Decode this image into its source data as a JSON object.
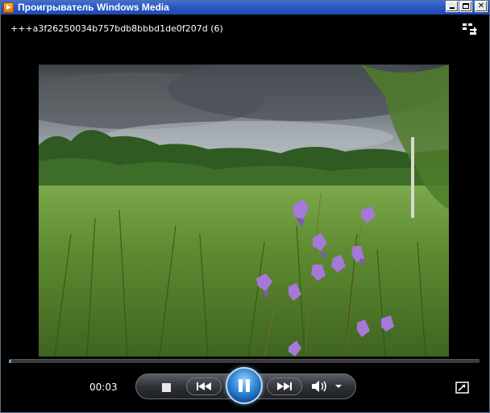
{
  "window": {
    "title": "Проигрыватель Windows Media",
    "minimize_icon": "minimize-icon",
    "maximize_icon": "maximize-icon",
    "close_label": "✕"
  },
  "now_playing": {
    "title": "+++a3f26250034b757bdb8bbbd1de0f207d (6)"
  },
  "playback": {
    "elapsed": "00:03",
    "progress": 0.005,
    "state": "playing"
  },
  "controls": {
    "stop_icon": "stop-icon",
    "previous_icon": "previous-icon",
    "pause_icon": "pause-icon",
    "next_icon": "next-icon",
    "volume_icon": "speaker-icon",
    "volume_dropdown_icon": "chevron-down-icon",
    "fullscreen_icon": "fullscreen-icon",
    "switch_to_library_icon": "switch-to-library-icon"
  },
  "colors": {
    "titlebar": "#2a58c2",
    "play_button": "#3a8fdc",
    "background": "#000000"
  }
}
